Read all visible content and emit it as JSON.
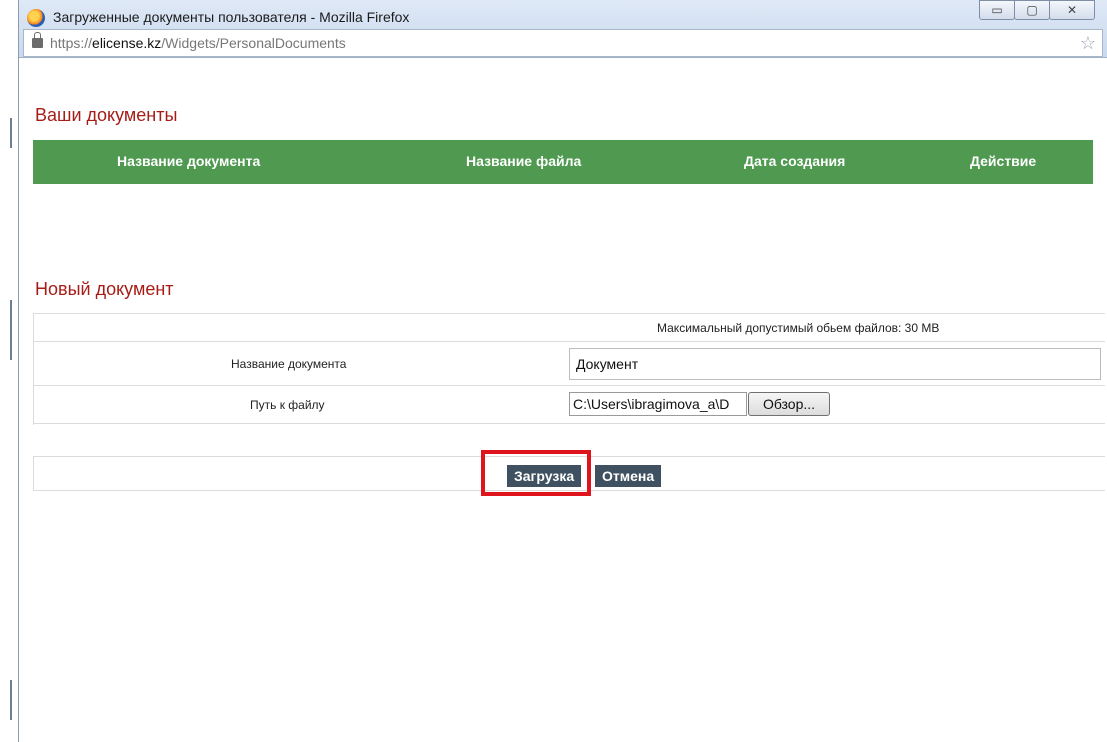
{
  "window": {
    "title": "Загруженные документы пользователя - Mozilla Firefox",
    "controls": {
      "minimize": "▭",
      "maximize": "▢",
      "close": "✕"
    }
  },
  "urlbar": {
    "scheme": "https://",
    "host": "elicense.kz",
    "path": "/Widgets/PersonalDocuments",
    "icons": {
      "lock": "lock-icon",
      "bookmark": "star-icon"
    }
  },
  "docs": {
    "heading": "Ваши документы",
    "columns": [
      "Название документа",
      "Название файла",
      "Дата создания",
      "Действие"
    ],
    "header_color": "#4f9a50"
  },
  "new_doc": {
    "heading": "Новый документ",
    "max_size_text": "Максимальный допустимый обьем файлов: 30 MB",
    "name_label": "Название документа",
    "name_value": "Документ",
    "path_label": "Путь к файлу",
    "path_value": "C:\\Users\\ibragimova_a\\D",
    "browse_label": "Обзор..."
  },
  "actions": {
    "upload_label": "Загрузка",
    "cancel_label": "Отмена"
  },
  "colors": {
    "heading": "#a61d18",
    "button": "#3f5060",
    "highlight": "#e0141c"
  }
}
